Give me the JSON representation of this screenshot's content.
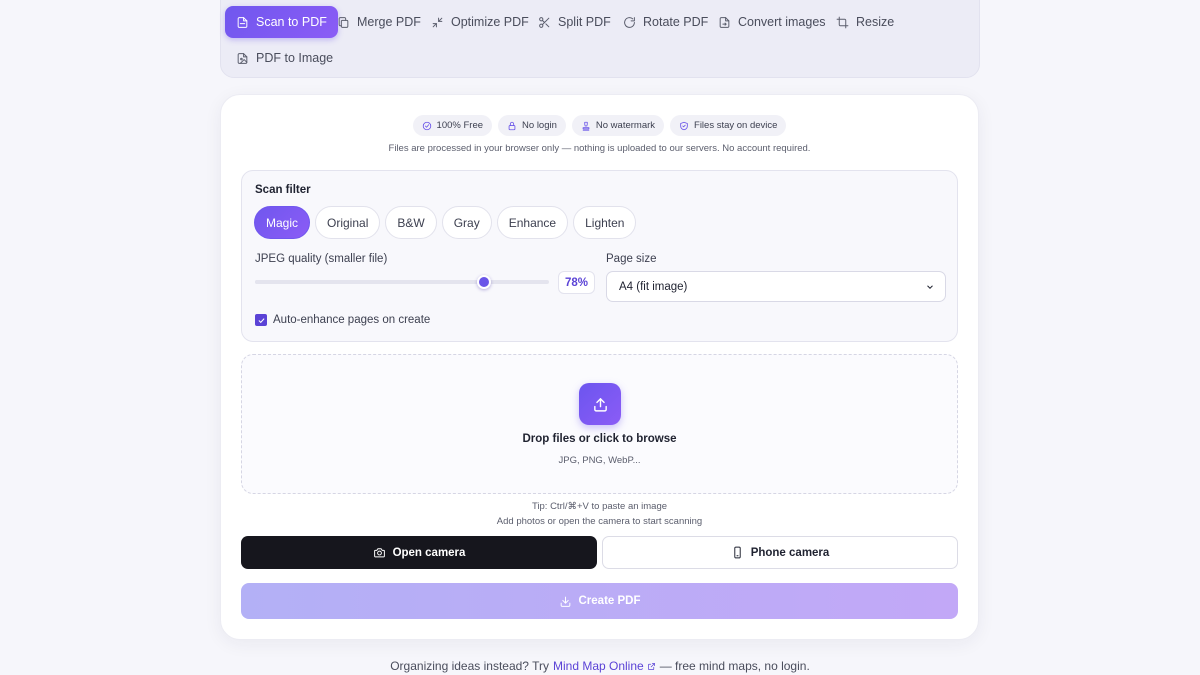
{
  "nav": {
    "items": [
      {
        "label": "Scan to PDF",
        "icon": "file-scan-icon",
        "active": true
      },
      {
        "label": "Merge PDF",
        "icon": "copy-icon",
        "active": false
      },
      {
        "label": "Optimize PDF",
        "icon": "minimize-icon",
        "active": false
      },
      {
        "label": "Split PDF",
        "icon": "scissors-icon",
        "active": false
      },
      {
        "label": "Rotate PDF",
        "icon": "rotate-icon",
        "active": false
      },
      {
        "label": "Convert images",
        "icon": "file-convert-icon",
        "active": false
      },
      {
        "label": "Resize",
        "icon": "crop-icon",
        "active": false
      },
      {
        "label": "PDF to Image",
        "icon": "file-image-icon",
        "active": false
      }
    ]
  },
  "badges": [
    {
      "label": "100% Free",
      "icon": "check-circle-icon"
    },
    {
      "label": "No login",
      "icon": "lock-icon"
    },
    {
      "label": "No watermark",
      "icon": "stamp-icon"
    },
    {
      "label": "Files stay on device",
      "icon": "shield-icon"
    }
  ],
  "privacy_note": "Files are processed in your browser only — nothing is uploaded to our servers. No account required.",
  "settings": {
    "title": "Scan filter",
    "filters": [
      {
        "label": "Magic",
        "active": true
      },
      {
        "label": "Original",
        "active": false
      },
      {
        "label": "B&W",
        "active": false
      },
      {
        "label": "Gray",
        "active": false
      },
      {
        "label": "Enhance",
        "active": false
      },
      {
        "label": "Lighten",
        "active": false
      }
    ],
    "quality_label": "JPEG quality (smaller file)",
    "quality_value": "78%",
    "quality_fraction": 0.78,
    "page_size_label": "Page size",
    "page_size_value": "A4 (fit image)",
    "auto_enhance_label": "Auto-enhance pages on create",
    "auto_enhance_checked": true
  },
  "dropzone": {
    "title": "Drop files or click to browse",
    "formats": "JPG, PNG, WebP..."
  },
  "tip": "Tip: Ctrl/⌘+V to paste an image",
  "hint": "Add photos or open the camera to start scanning",
  "buttons": {
    "open_camera": "Open camera",
    "phone_camera": "Phone camera",
    "create_pdf": "Create PDF"
  },
  "footer": {
    "prefix": "Organizing ideas instead? Try",
    "link": "Mind Map Online",
    "suffix": "— free mind maps, no login."
  },
  "colors": {
    "accent": "#6a55e8",
    "dark_button": "#16161d",
    "create_button": "#b8adf7"
  }
}
